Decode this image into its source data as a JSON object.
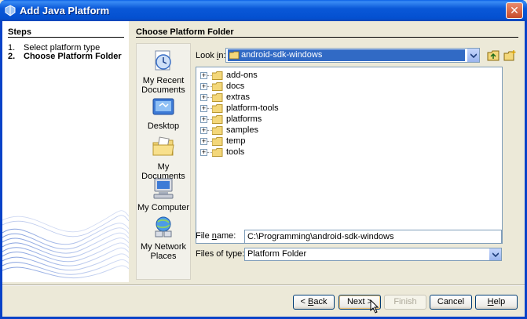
{
  "window": {
    "title": "Add Java Platform",
    "icon": "java-cup-icon",
    "close_label": "✕"
  },
  "steps": {
    "title": "Steps",
    "items": [
      {
        "num": "1.",
        "label": "Select platform type",
        "current": false
      },
      {
        "num": "2.",
        "label": "Choose Platform Folder",
        "current": true
      }
    ]
  },
  "main": {
    "section_title": "Choose Platform Folder"
  },
  "places": [
    {
      "label": "My Recent Documents",
      "icon": "recent-documents-icon"
    },
    {
      "label": "Desktop",
      "icon": "desktop-icon"
    },
    {
      "label": "My Documents",
      "icon": "my-documents-icon"
    },
    {
      "label": "My Computer",
      "icon": "my-computer-icon"
    },
    {
      "label": "My Network Places",
      "icon": "network-places-icon"
    }
  ],
  "look_in": {
    "label_pre": "Look ",
    "label_acc": "i",
    "label_post": "n:",
    "value": "android-sdk-windows"
  },
  "tree": {
    "items": [
      "add-ons",
      "docs",
      "extras",
      "platform-tools",
      "platforms",
      "samples",
      "temp",
      "tools"
    ]
  },
  "file_name": {
    "label_pre": "File ",
    "label_acc": "n",
    "label_post": "ame:",
    "value": "C:\\Programming\\android-sdk-windows"
  },
  "file_type": {
    "label": "Files of type:",
    "value": "Platform Folder"
  },
  "buttons": {
    "back_pre": "< ",
    "back_acc": "B",
    "back_post": "ack",
    "next": "Next >",
    "finish": "Finish",
    "cancel": "Cancel",
    "help_acc": "H",
    "help_post": "elp"
  },
  "colors": {
    "titlebar": "#0a58d8",
    "selection": "#316ac5",
    "folder": "#f3d77a"
  }
}
